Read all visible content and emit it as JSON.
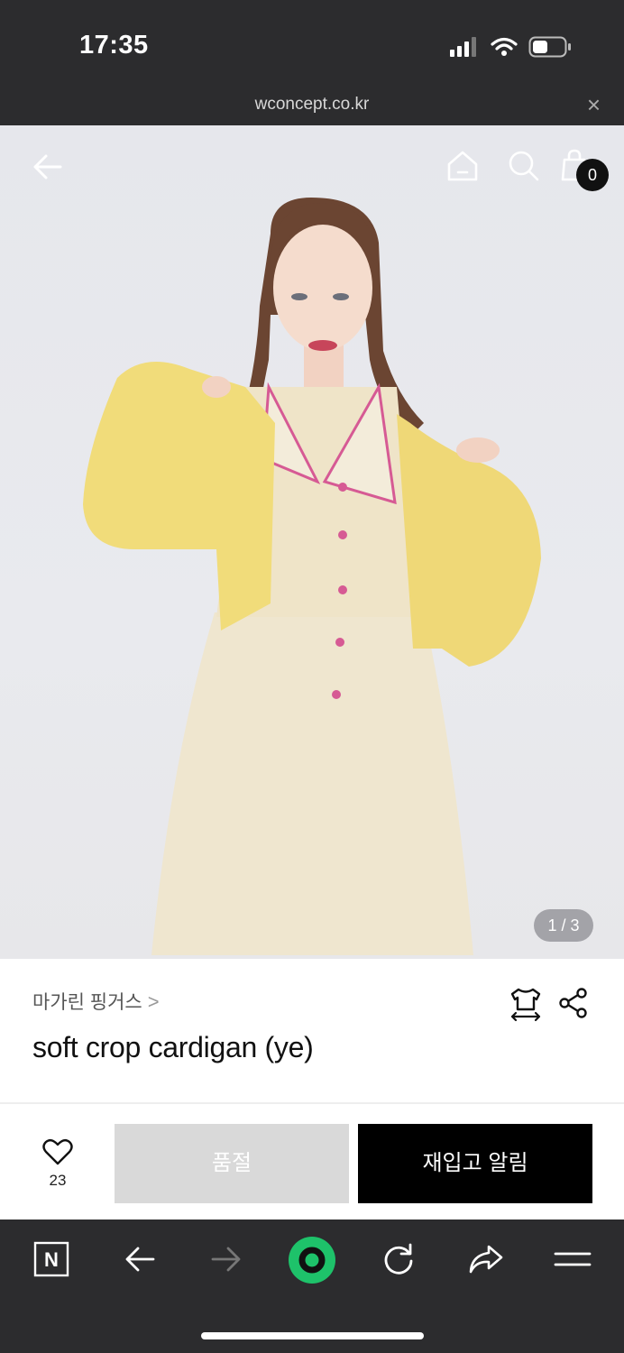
{
  "status_bar": {
    "time": "17:35"
  },
  "browser": {
    "url": "wconcept.co.kr",
    "close_label": "×"
  },
  "hero": {
    "cart_count": "0",
    "pager": "1 / 3"
  },
  "product": {
    "brand": "마가린 핑거스",
    "brand_chevron": ">",
    "name": "soft crop cardigan (ye)"
  },
  "actions": {
    "like_count": "23",
    "soldout_label": "품절",
    "restock_label": "재입고 알림"
  },
  "toolbar": {
    "naver_label": "N"
  },
  "colors": {
    "cardigan": "#f1dc7a",
    "dress": "#efe6cf",
    "accent": "#d65a94",
    "toolbar_bg": "#2c2c2e",
    "green_button": "#1ec26a"
  }
}
